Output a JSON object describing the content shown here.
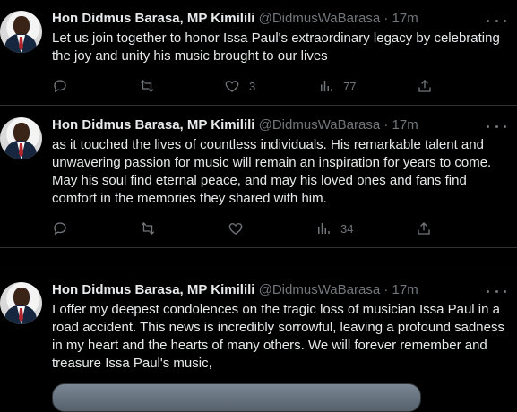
{
  "tweets": [
    {
      "author_name": "Hon Didmus Barasa, MP Kimilili",
      "handle": "@DidmusWaBarasa",
      "separator": "·",
      "time": "17m",
      "text": "Let us join together to honor Issa Paul's extraordinary legacy by celebrating the joy and unity his music brought to our lives",
      "likes": "3",
      "views": "77"
    },
    {
      "author_name": "Hon Didmus Barasa, MP Kimilili",
      "handle": "@DidmusWaBarasa",
      "separator": "·",
      "time": "17m",
      "text": "as it touched the lives of countless individuals. His remarkable talent and unwavering passion for music will remain an inspiration for years to come. May his soul find eternal peace, and may his loved ones and fans find comfort in the memories they shared with him.",
      "likes": "",
      "views": "34"
    },
    {
      "author_name": "Hon Didmus Barasa, MP Kimilili",
      "handle": "@DidmusWaBarasa",
      "separator": "·",
      "time": "17m",
      "text": "I offer my deepest condolences on the tragic loss of musician Issa Paul in a road accident. This news is incredibly sorrowful, leaving a profound sadness in my heart and the hearts of many others. We will forever remember and treasure Issa Paul's music,"
    }
  ],
  "icons": {
    "reply": "reply-icon",
    "retweet": "retweet-icon",
    "like": "heart-icon",
    "views": "views-icon",
    "share": "share-icon",
    "more": "more-icon"
  },
  "colors": {
    "background": "#000000",
    "text": "#e7e9ea",
    "muted": "#71767b",
    "divider": "#2f3336"
  }
}
